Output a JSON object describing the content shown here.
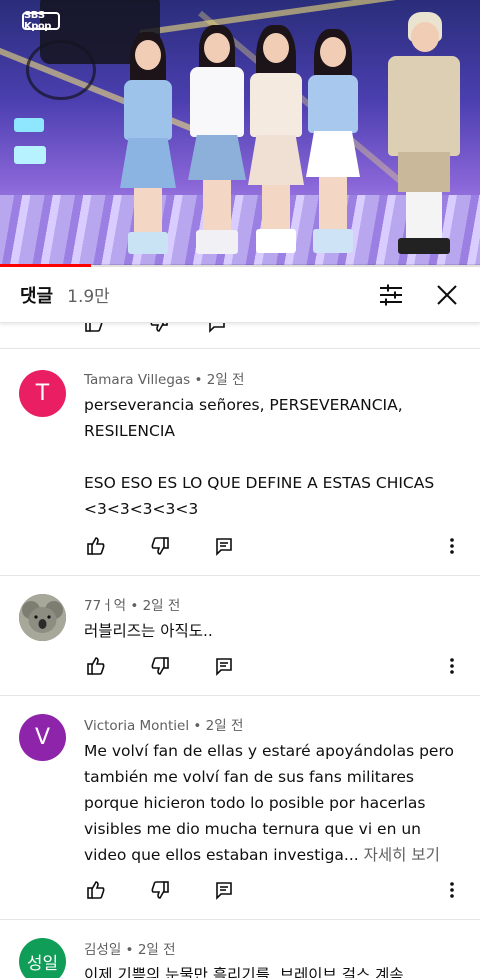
{
  "video": {
    "channel_logo_text": "SBS Kpop",
    "progress_fraction": 0.19
  },
  "comments_header": {
    "title": "댓글",
    "count": "1.9만",
    "icons": [
      "sort-icon",
      "close-icon"
    ]
  },
  "comments": [
    {
      "avatar_letter": "T",
      "avatar_color": "#e91e63",
      "author": "Tamara Villegas",
      "time": "2일 전",
      "text": "perseverancia señores, PERSEVERANCIA, RESILENCIA\n\nESO ESO ES LO QUE DEFINE A ESTAS CHICAS <3<3<3<3<3"
    },
    {
      "avatar_letter": "",
      "avatar_color": "#6b6b5a",
      "author": "77ㅓ억",
      "time": "2일 전",
      "text": "러블리즈는 아직도.."
    },
    {
      "avatar_letter": "V",
      "avatar_color": "#8e24aa",
      "author": "Victoria Montiel",
      "time": "2일 전",
      "text": "Me volví fan de ellas y estaré apoyándolas pero también me volví fan de sus fans militares porque hicieron todo lo posible por hacerlas visibles me dio mucha ternura que vi en un video que ellos estaban investiga... ",
      "more": "자세히 보기"
    },
    {
      "avatar_letter": "성일",
      "avatar_color": "#0f9d58",
      "author": "김성일",
      "time": "2일 전",
      "text": "이제 기쁨의 눈물만 흘리기를..브레이브 걸스 계속"
    }
  ]
}
